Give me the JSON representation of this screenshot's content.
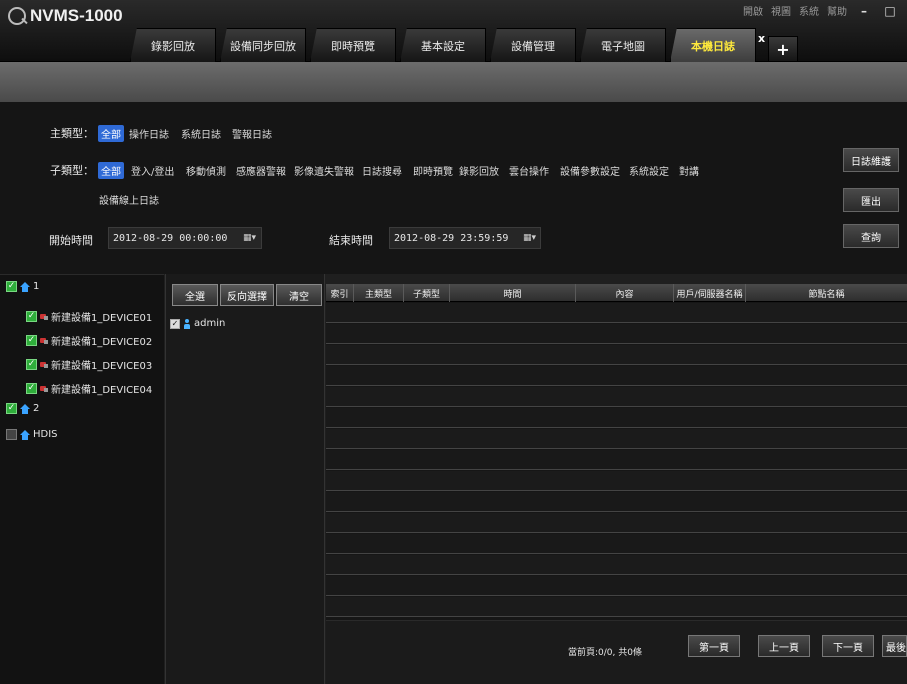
{
  "app": {
    "title": "NVMS-1000"
  },
  "top_links": [
    "開啟",
    "視圖",
    "系統",
    "幫助"
  ],
  "tabs": [
    {
      "label": "錄影回放"
    },
    {
      "label": "設備同步回放"
    },
    {
      "label": "即時預覽"
    },
    {
      "label": "基本設定"
    },
    {
      "label": "設備管理"
    },
    {
      "label": "電子地圖"
    },
    {
      "label": "本機日誌",
      "active": true
    }
  ],
  "tab_close": "x",
  "tab_add": "+",
  "filter": {
    "main_type_label": "主類型：",
    "main_types": [
      "全部",
      "操作日誌",
      "系統日誌",
      "警報日誌"
    ],
    "main_selected": 0,
    "sub_type_label": "子類型：",
    "sub_types": [
      "全部",
      "登入/登出",
      "移動偵測",
      "感應器警報",
      "影像遺失警報",
      "日誌搜尋",
      "即時預覽",
      "錄影回放",
      "雲台操作",
      "設備參數設定",
      "系統設定",
      "對講",
      "設備線上日誌"
    ],
    "sub_selected": 0,
    "start_label": "開始時間",
    "start_value": "2012-08-29 00:00:00",
    "end_label": "結束時間",
    "end_value": "2012-08-29 23:59:59",
    "btn_maintain": "日誌維護",
    "btn_export": "匯出",
    "btn_query": "查詢"
  },
  "tree": {
    "nodes": [
      {
        "label": "1",
        "type": "group",
        "checked": true
      },
      {
        "label": "新建設備1_DEVICE01",
        "type": "device",
        "checked": true
      },
      {
        "label": "新建設備1_DEVICE02",
        "type": "device",
        "checked": true
      },
      {
        "label": "新建設備1_DEVICE03",
        "type": "device",
        "checked": true
      },
      {
        "label": "新建設備1_DEVICE04",
        "type": "device",
        "checked": true
      },
      {
        "label": "2",
        "type": "group",
        "checked": true
      },
      {
        "label": "HDIS",
        "type": "group",
        "checked": false
      }
    ]
  },
  "users_panel": {
    "btn_select_all": "全選",
    "btn_invert": "反向選擇",
    "btn_clear": "清空",
    "users": [
      {
        "name": "admin",
        "checked": true
      }
    ]
  },
  "table": {
    "columns": [
      "索引",
      "主類型",
      "子類型",
      "時間",
      "內容",
      "用戶/伺服器名稱",
      "節點名稱"
    ],
    "rows": []
  },
  "pager": {
    "info": "當前頁:0/0, 共0條",
    "btn_first": "第一頁",
    "btn_prev": "上一頁",
    "btn_next": "下一頁",
    "btn_last": "最後"
  }
}
